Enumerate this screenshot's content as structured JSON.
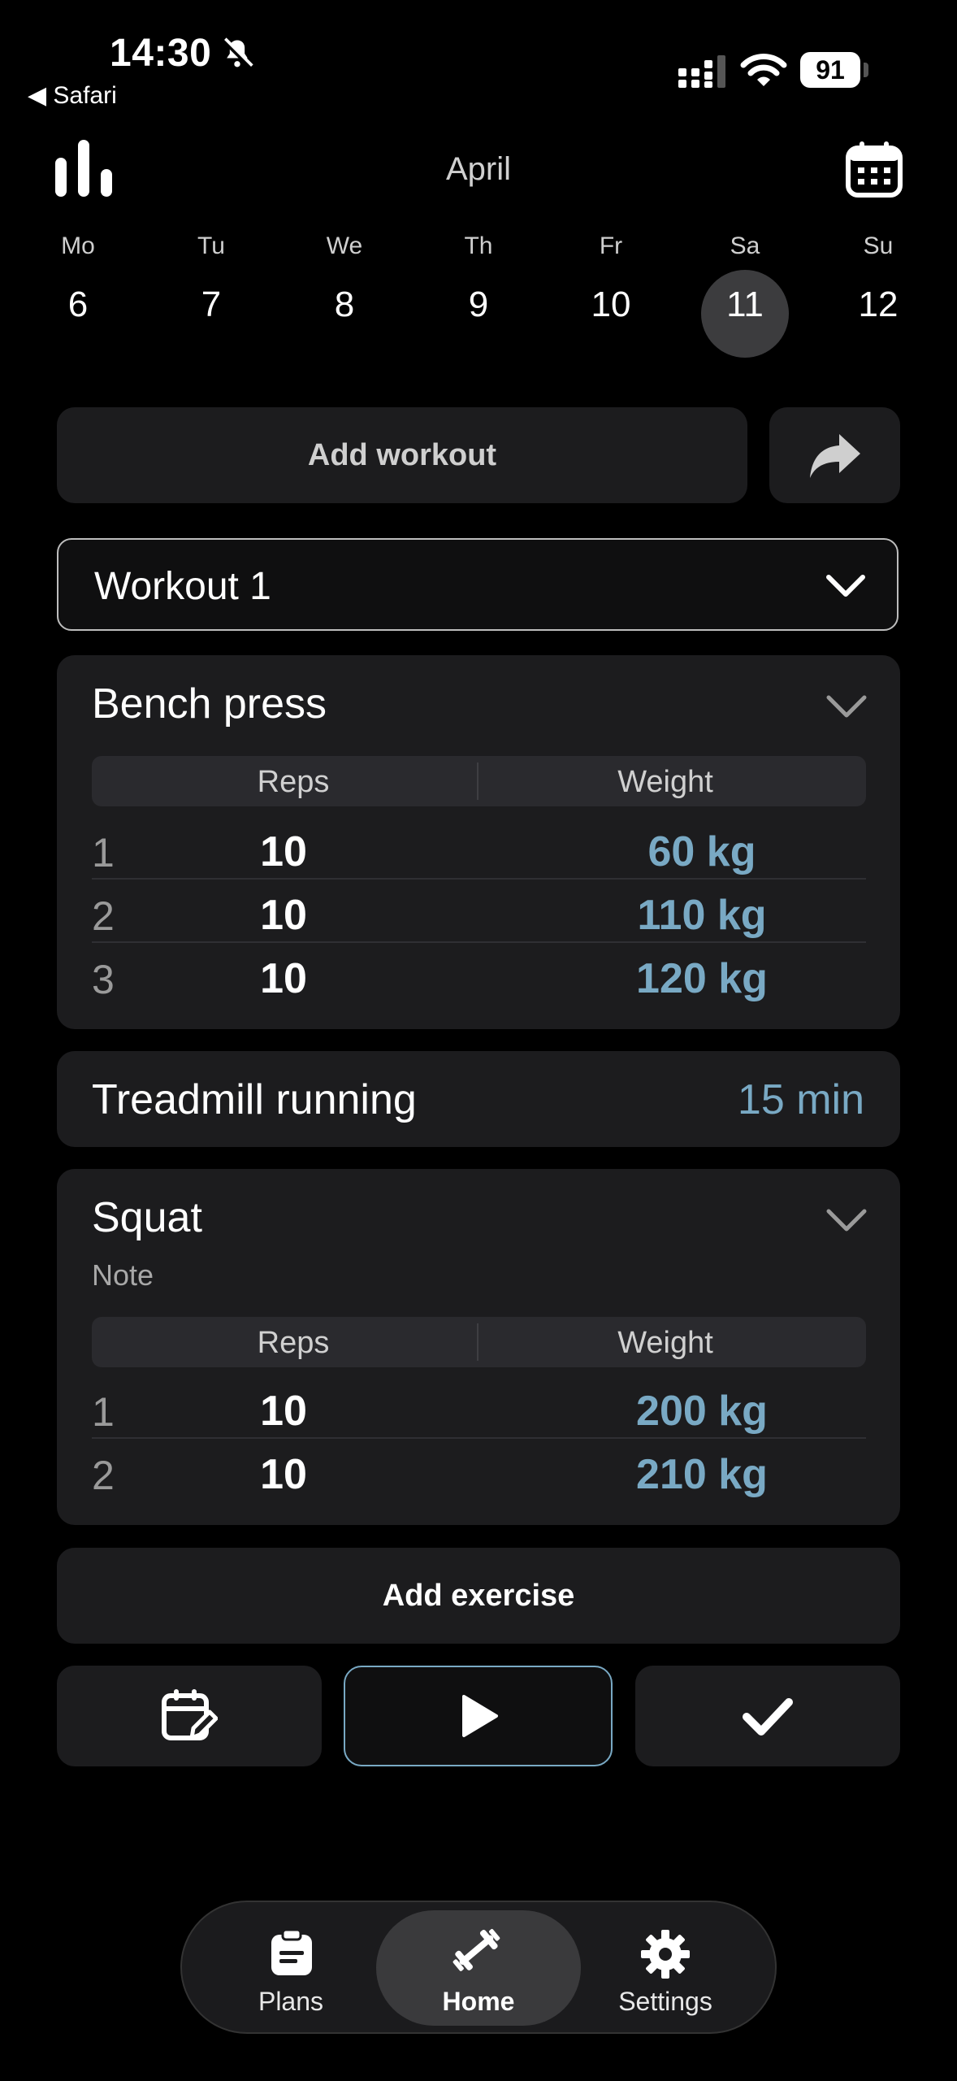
{
  "status_bar": {
    "time": "14:30",
    "back_app": "◀ Safari",
    "battery": "91"
  },
  "header": {
    "month": "April"
  },
  "week": [
    {
      "name": "Mo",
      "num": "6"
    },
    {
      "name": "Tu",
      "num": "7"
    },
    {
      "name": "We",
      "num": "8"
    },
    {
      "name": "Th",
      "num": "9"
    },
    {
      "name": "Fr",
      "num": "10"
    },
    {
      "name": "Sa",
      "num": "11",
      "selected": true
    },
    {
      "name": "Su",
      "num": "12"
    }
  ],
  "actions": {
    "add_workout": "Add workout",
    "add_exercise": "Add exercise"
  },
  "workout_select": {
    "value": "Workout 1"
  },
  "exercises": {
    "bench": {
      "title": "Bench press",
      "col_reps": "Reps",
      "col_weight": "Weight",
      "sets": [
        {
          "idx": "1",
          "reps": "10",
          "weight": "60 kg"
        },
        {
          "idx": "2",
          "reps": "10",
          "weight": "110 kg"
        },
        {
          "idx": "3",
          "reps": "10",
          "weight": "120 kg"
        }
      ]
    },
    "treadmill": {
      "title": "Treadmill running",
      "duration": "15 min"
    },
    "squat": {
      "title": "Squat",
      "note": "Note",
      "col_reps": "Reps",
      "col_weight": "Weight",
      "sets": [
        {
          "idx": "1",
          "reps": "10",
          "weight": "200 kg"
        },
        {
          "idx": "2",
          "reps": "10",
          "weight": "210 kg"
        }
      ]
    }
  },
  "tabs": {
    "plans": "Plans",
    "home": "Home",
    "settings": "Settings"
  },
  "colors": {
    "accent": "#79a9c4",
    "card": "#1c1c1e",
    "background": "#000000"
  }
}
